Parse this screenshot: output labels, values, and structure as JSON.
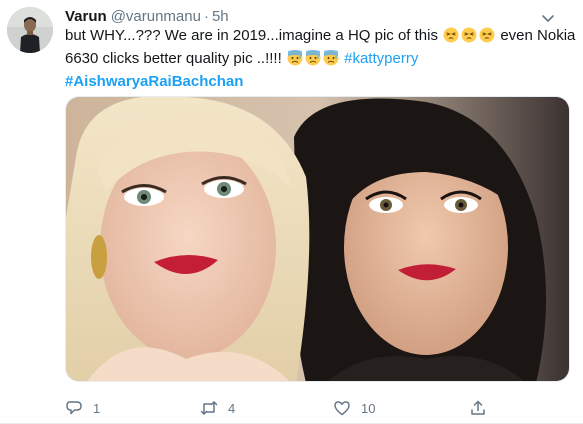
{
  "tweet": {
    "author_name": "Varun",
    "author_handle": "@varunmanu",
    "separator": "·",
    "timestamp": "5h",
    "text_line1_part1": "but WHY...??? We are in 2019...imagine a HQ pic of this",
    "text_line1_part2": "even Nokia",
    "text_line2_part1": "6630 clicks better quality pic ..!!!!",
    "hashtag1": "#kattyperry",
    "hashtag2": "#AishwaryaRaiBachchan",
    "emoji_group1": [
      "tired-face",
      "tired-face",
      "tired-face"
    ],
    "emoji_group2": [
      "sweat-face",
      "sweat-face",
      "sweat-face"
    ]
  },
  "actions": {
    "reply_count": "1",
    "retweet_count": "4",
    "like_count": "10"
  },
  "colors": {
    "link": "#1da1f2",
    "text": "#14171a",
    "muted": "#657786"
  },
  "icons": {
    "reply": "reply-icon",
    "retweet": "retweet-icon",
    "like": "heart-icon",
    "share": "share-icon",
    "more": "chevron-down-icon"
  }
}
